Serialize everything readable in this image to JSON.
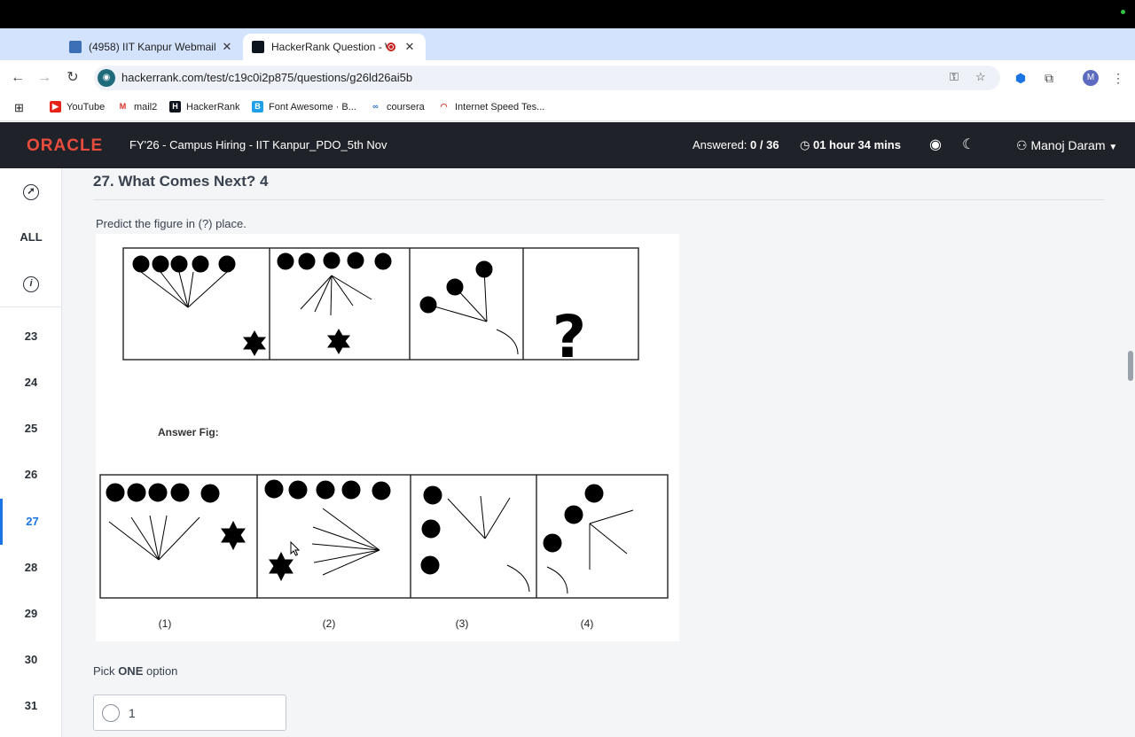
{
  "browser": {
    "tabs": [
      {
        "title": "(4958) IIT Kanpur Webmail ::",
        "active": false
      },
      {
        "title": "HackerRank Question - W",
        "active": true
      }
    ],
    "url": "hackerrank.com/test/c19c0i2p875/questions/g26ld26ai5b",
    "bookmarks": [
      "YouTube",
      "mail2",
      "HackerRank",
      "Font Awesome · B...",
      "coursera",
      "Internet Speed Tes..."
    ],
    "profile_initial": "M"
  },
  "header": {
    "logo": "ORACLE",
    "test_name": "FY'26 - Campus Hiring - IIT Kanpur_PDO_5th Nov",
    "answered_label": "Answered:",
    "answered_value": "0 / 36",
    "timer": "01 hour 34 mins",
    "user_name": "Manoj Daram"
  },
  "sidebar": {
    "all_label": "ALL",
    "questions": [
      "23",
      "24",
      "25",
      "26",
      "27",
      "28",
      "29",
      "30",
      "31"
    ],
    "active_question": "27"
  },
  "question": {
    "title": "27. What Comes Next? 4",
    "prompt": "Predict the figure in (?) place.",
    "figure": {
      "question_mark": "?",
      "answer_caption": "Answer Fig:",
      "option_labels": [
        "(1)",
        "(2)",
        "(3)",
        "(4)"
      ]
    },
    "pick_prefix": "Pick",
    "pick_bold": "ONE",
    "pick_suffix": "option",
    "options": [
      "1"
    ]
  },
  "colors": {
    "header_bg": "#1f2329",
    "oracle_red": "#e84c3d",
    "active_accent": "#1b74e4",
    "tabstrip": "#d3e3fd"
  }
}
